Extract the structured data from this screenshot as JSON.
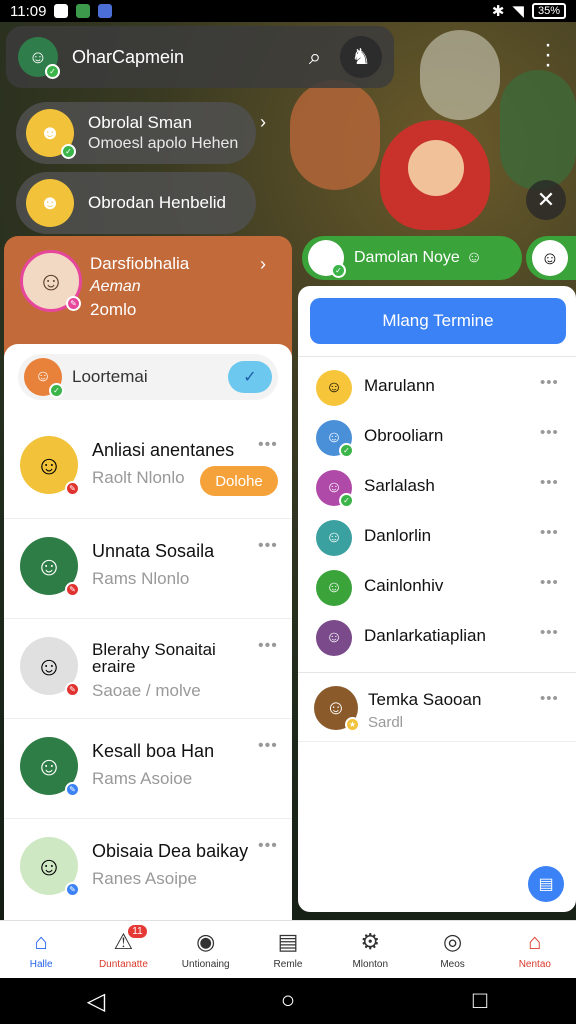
{
  "status_bar": {
    "time": "11:09",
    "battery": "35%"
  },
  "topbar": {
    "title": "OharCapmein"
  },
  "chips": [
    {
      "line1": "Obrolal Sman",
      "line2": "Omoesl apolo Hehen"
    },
    {
      "line1": "Obrodan Henbelid",
      "line2": ""
    }
  ],
  "profile_card": {
    "name": "Darsfiobhalia",
    "role": "Aeman",
    "time": "2omlo"
  },
  "left_list": {
    "search_text": "Loortemai",
    "items": [
      {
        "name": "Anliasi anentanes",
        "sub": "Raolt Nlonlo",
        "badge": "Dolohe"
      },
      {
        "name": "Unnata Sosaila",
        "sub": "Rams Nlonlo",
        "badge": ""
      },
      {
        "name": "Blerahy Sonaitai eraire",
        "sub": "Saoae / molve",
        "badge": ""
      },
      {
        "name": "Kesall boa Han",
        "sub": "Rams Asoioe",
        "badge": ""
      },
      {
        "name": "Obisaia Dea baikay",
        "sub": "Ranes Asoipe",
        "badge": ""
      }
    ]
  },
  "green_chip": {
    "label": "Damolan Noye"
  },
  "right_panel": {
    "button_label": "Mlang Termine",
    "items": [
      {
        "name": "Marulann"
      },
      {
        "name": "Obrooliarn"
      },
      {
        "name": "Sarlalash"
      },
      {
        "name": "Danlorlin"
      },
      {
        "name": "Cainlonhiv"
      },
      {
        "name": "Danlarkatiaplian"
      }
    ],
    "special": {
      "name": "Temka Saooan",
      "sub": "Sardl"
    }
  },
  "bottom_nav": [
    {
      "label": "Halle"
    },
    {
      "label": "Duntanatte",
      "notif": "11"
    },
    {
      "label": "Untionaing"
    },
    {
      "label": "Remle"
    },
    {
      "label": "Mlonton"
    },
    {
      "label": "Meos"
    },
    {
      "label": "Nentao"
    }
  ],
  "colors": {
    "accent": "#3b82f6",
    "orange": "#c26a3a",
    "green": "#3aa33a",
    "badge": "#f5a23a"
  }
}
